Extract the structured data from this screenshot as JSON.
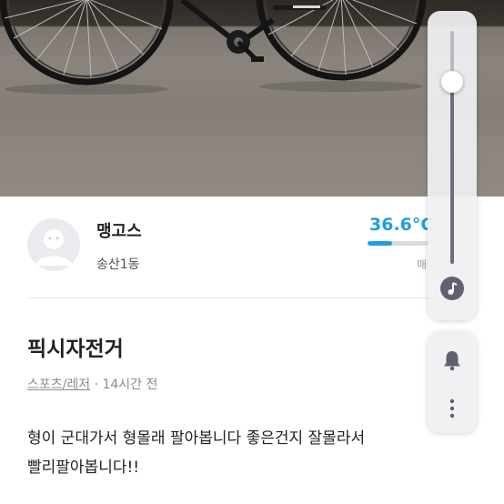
{
  "seller": {
    "name": "맹고스",
    "location": "송산1동",
    "manner_temp": "36.6°C",
    "manner_temp_fill": 0.38,
    "manner_caption": "매너온도"
  },
  "post": {
    "title": "픽시자전거",
    "category": "스포츠/레저",
    "time_ago": "· 14시간 전",
    "body_lines": [
      "형이 군대가서 형몰래 팔아봅니다 좋은건지 잘몰라서",
      "빨리팔아봅니다!!"
    ]
  },
  "volume_panel": {
    "level": 0.78,
    "mode_icon": "music-note-icon",
    "ring_icon": "bell-icon",
    "more_icon": "more-vertical-icon"
  },
  "colors": {
    "accent_temp": "#1f9fe0",
    "panel_bg": "#f0f0f3",
    "track_fill": "#6d6d84"
  }
}
